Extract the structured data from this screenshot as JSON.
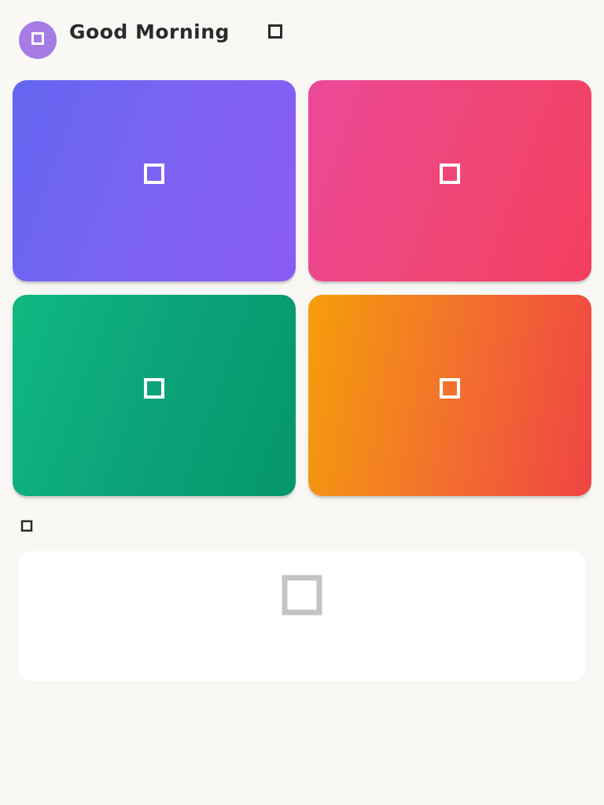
{
  "header": {
    "title": "Good Morning",
    "badge": "",
    "subtitle": "",
    "avatar_icon": "user-icon",
    "title_icon": "sun-icon"
  },
  "cards": [
    {
      "id": "card-1",
      "icon": "edit-icon",
      "title": "",
      "subtitle": "",
      "gradient": [
        "#6366f1",
        "#8b5cf6"
      ]
    },
    {
      "id": "card-2",
      "icon": "heart-icon",
      "title": "",
      "subtitle": "",
      "gradient": [
        "#ec4899",
        "#f43f5e"
      ]
    },
    {
      "id": "card-3",
      "icon": "leaf-icon",
      "title": "",
      "subtitle": "",
      "gradient": [
        "#10b981",
        "#059669"
      ]
    },
    {
      "id": "card-4",
      "icon": "star-icon",
      "title": "",
      "subtitle": "",
      "gradient": [
        "#f59e0b",
        "#ef4444"
      ]
    }
  ],
  "recent": {
    "title": "",
    "icon": "clock-icon",
    "empty_icon": "inbox-icon",
    "empty_text": ""
  },
  "colors": {
    "background": "#f9f8f5",
    "avatar": "#a57ce4",
    "heading": "#2a2a2a",
    "muted": "#7b7b7b"
  }
}
